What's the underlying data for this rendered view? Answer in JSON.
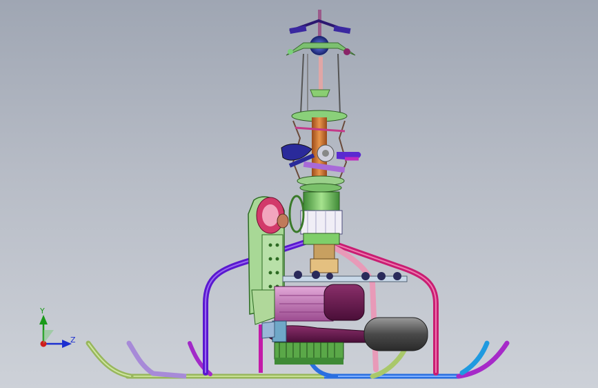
{
  "viewport": {
    "background_top": "#9fa6b3",
    "background_bottom": "#cdd1d8"
  },
  "triad": {
    "y_label": "Y",
    "z_label": "Z",
    "y_color": "#1a9a1a",
    "z_color": "#1c2fd0",
    "x_color": "#d01c1c"
  },
  "model": {
    "name_icon": "helicopter-rotor-head-assembly-icon",
    "colors": {
      "skid_green": "#a9c86a",
      "skid_blue": "#2a6fe0",
      "frame_purple": "#6a1ee0",
      "frame_magenta": "#d0207a",
      "frame_pink": "#e79ab6",
      "shaft_orange": "#d4742c",
      "gear_green": "#6fc25a",
      "engine_pink": "#c774b8",
      "muffler_gray": "#6b6b6b"
    }
  }
}
